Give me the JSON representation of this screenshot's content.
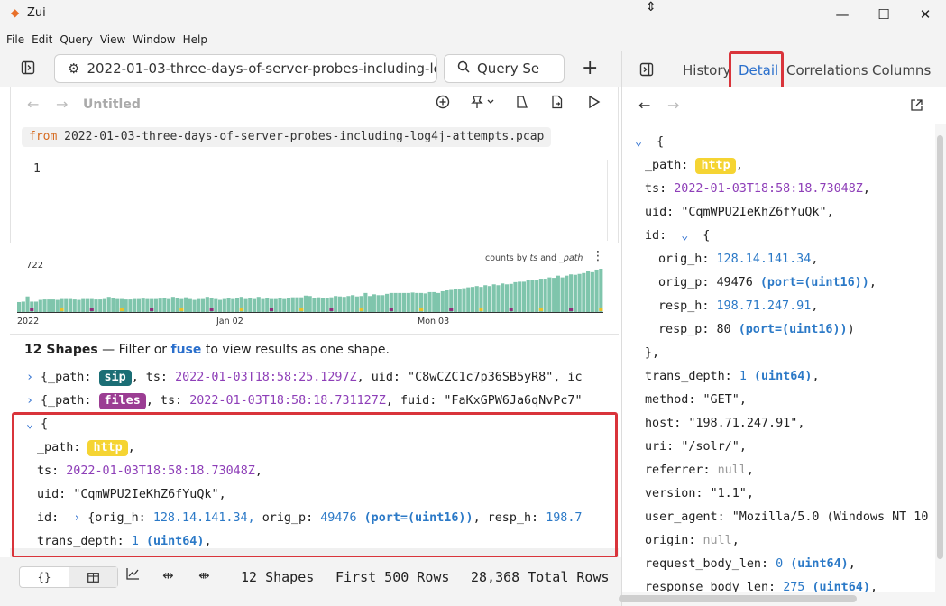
{
  "window": {
    "title": "Zui",
    "minimize": "—",
    "maximize": "☐",
    "close": "✕"
  },
  "menu": [
    "File",
    "Edit",
    "Query",
    "View",
    "Window",
    "Help"
  ],
  "tabs": {
    "pool_tab": "2022-01-03-three-days-of-server-probes-including-lo",
    "query_tab": "Query Se",
    "add": "+"
  },
  "right_tabs": [
    "History",
    "Detail",
    "Correlations",
    "Columns"
  ],
  "query": {
    "title": "Untitled",
    "from_keyword": "from",
    "from_value": "2022-01-03-three-days-of-server-probes-including-log4j-attempts.pcap",
    "line_number": "1"
  },
  "histogram": {
    "max_label": "722",
    "caption_prefix": "counts by",
    "caption_field1": "ts",
    "caption_and": "and",
    "caption_field2": "_path",
    "dates": [
      "2022",
      "Jan 02",
      "Mon 03"
    ],
    "colors": {
      "base": "#7fc5ac",
      "accent1": "#8f2f7a",
      "accent2": "#e8c12c",
      "accent3": "#1e6f76"
    },
    "values": [
      0.23,
      0.24,
      0.36,
      0.24,
      0.24,
      0.28,
      0.29,
      0.29,
      0.29,
      0.28,
      0.3,
      0.3,
      0.3,
      0.29,
      0.28,
      0.3,
      0.3,
      0.3,
      0.29,
      0.29,
      0.3,
      0.35,
      0.33,
      0.3,
      0.3,
      0.29,
      0.29,
      0.3,
      0.3,
      0.31,
      0.3,
      0.3,
      0.3,
      0.31,
      0.33,
      0.3,
      0.35,
      0.32,
      0.3,
      0.34,
      0.3,
      0.28,
      0.3,
      0.3,
      0.35,
      0.32,
      0.3,
      0.28,
      0.3,
      0.33,
      0.3,
      0.33,
      0.35,
      0.3,
      0.32,
      0.3,
      0.35,
      0.3,
      0.33,
      0.3,
      0.3,
      0.33,
      0.3,
      0.32,
      0.34,
      0.34,
      0.34,
      0.38,
      0.37,
      0.33,
      0.34,
      0.33,
      0.32,
      0.34,
      0.37,
      0.36,
      0.35,
      0.37,
      0.39,
      0.36,
      0.37,
      0.44,
      0.37,
      0.41,
      0.39,
      0.39,
      0.42,
      0.44,
      0.44,
      0.44,
      0.44,
      0.44,
      0.45,
      0.44,
      0.44,
      0.43,
      0.46,
      0.46,
      0.44,
      0.48,
      0.5,
      0.51,
      0.54,
      0.52,
      0.55,
      0.57,
      0.58,
      0.6,
      0.58,
      0.62,
      0.6,
      0.64,
      0.62,
      0.66,
      0.64,
      0.65,
      0.69,
      0.7,
      0.7,
      0.73,
      0.75,
      0.74,
      0.77,
      0.77,
      0.8,
      0.79,
      0.84,
      0.8,
      0.84,
      0.87,
      0.86,
      0.88,
      0.9,
      0.95,
      0.92,
      0.98,
      1.0
    ]
  },
  "results": {
    "count_label": "12 Shapes",
    "hint_pre": " — Filter or ",
    "fuse": "fuse",
    "hint_post": " to view results as one shape.",
    "row1": {
      "path": "sip",
      "ts": "2022-01-03T18:58:25.1297Z",
      "uid": "\"C8wCZC1c7p36SB5yR8\"",
      "tail": "ic"
    },
    "row2": {
      "path": "files",
      "ts": "2022-01-03T18:58:18.731127Z",
      "fuid": "\"FaKxGPW6Ja6qNvPc7\""
    },
    "expanded": {
      "path": "http",
      "ts": "2022-01-03T18:58:18.73048Z",
      "uid": "\"CqmWPU2IeKhZ6fYuQk\"",
      "orig_h": "128.14.141.34,",
      "orig_p": "49476",
      "port_type": "(port=(uint16))",
      "resp_h": "198.7",
      "trans_depth": "1",
      "uint64": "(uint64)"
    }
  },
  "status": {
    "shapes": "12 Shapes",
    "rows": "First 500 Rows",
    "total": "28,368 Total Rows"
  },
  "detail": {
    "path": "http",
    "ts": "2022-01-03T18:58:18.73048Z",
    "uid": "\"CqmWPU2IeKhZ6fYuQk\"",
    "orig_h": "128.14.141.34",
    "orig_p": "49476",
    "resp_h": "198.71.247.91",
    "resp_p": "80",
    "port_type": "(port=(uint16))",
    "trans_depth": "1",
    "method": "\"GET\"",
    "host": "\"198.71.247.91\"",
    "uri": "\"/solr/\"",
    "version": "\"1.1\"",
    "user_agent": "\"Mozilla/5.0 (Windows NT 10",
    "request_body_len": "0",
    "response_body_len": "275",
    "uint64": "(uint64)",
    "null": "null"
  }
}
